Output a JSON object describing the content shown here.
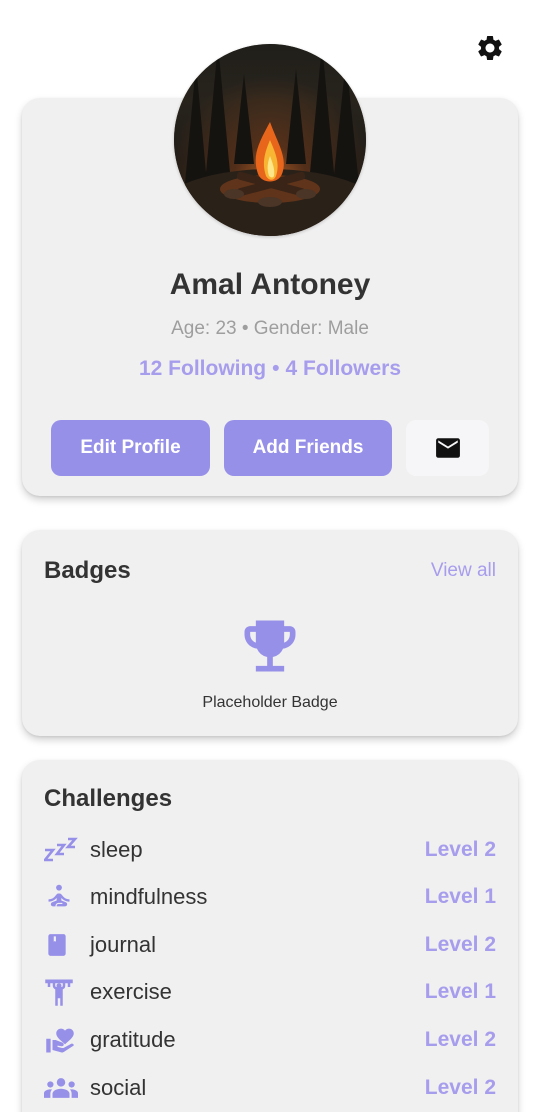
{
  "profile": {
    "name": "Amal Antoney",
    "age_label": "Age: 23",
    "gender_label": "Gender: Male",
    "separator": "•",
    "following_label": "12 Following",
    "followers_label": "4 Followers"
  },
  "actions": {
    "edit_profile": "Edit Profile",
    "add_friends": "Add Friends"
  },
  "badges": {
    "title": "Badges",
    "view_all": "View all",
    "items": [
      {
        "label": "Placeholder Badge",
        "icon": "trophy-icon"
      }
    ]
  },
  "challenges": {
    "title": "Challenges",
    "items": [
      {
        "name": "sleep",
        "level": "Level 2",
        "icon": "sleep-zzz-icon"
      },
      {
        "name": "mindfulness",
        "level": "Level 1",
        "icon": "meditation-icon"
      },
      {
        "name": "journal",
        "level": "Level 2",
        "icon": "book-icon"
      },
      {
        "name": "exercise",
        "level": "Level 1",
        "icon": "weightlifting-icon"
      },
      {
        "name": "gratitude",
        "level": "Level 2",
        "icon": "heart-hand-icon"
      },
      {
        "name": "social",
        "level": "Level 2",
        "icon": "group-icon"
      }
    ]
  },
  "colors": {
    "accent": "#9790e9",
    "accent_text": "#a79ded",
    "card_bg": "#f0f0f0",
    "muted_text": "#9e9e9e"
  }
}
